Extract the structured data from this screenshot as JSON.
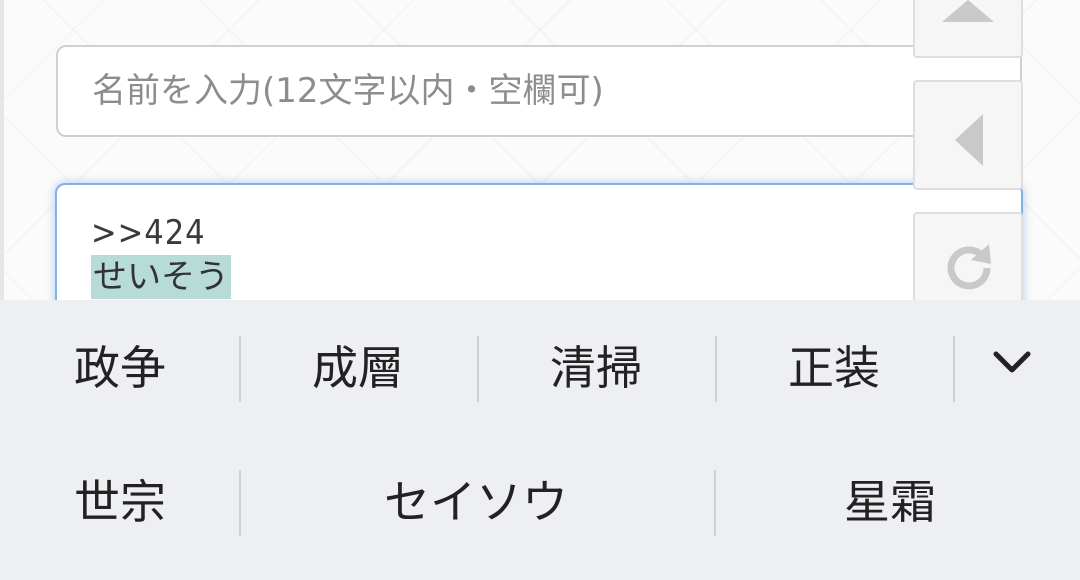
{
  "form": {
    "name_placeholder": "名前を入力(12文字以内・空欄可)",
    "name_value": "",
    "comment_line1": ">>424",
    "comment_composing": "せいそう"
  },
  "side_buttons": [
    {
      "icon": "triangle-up-icon"
    },
    {
      "icon": "triangle-left-icon"
    },
    {
      "icon": "reload-icon"
    }
  ],
  "ime": {
    "row1": [
      "政争",
      "成層",
      "清掃",
      "正装"
    ],
    "row2": [
      "世宗",
      "セイソウ",
      "星霜"
    ],
    "expand_icon": "chevron-down-icon"
  },
  "colors": {
    "accent_border": "#7fb2e6",
    "composing_highlight": "#b7dcd8",
    "keyboard_bg": "#eeeff3"
  }
}
